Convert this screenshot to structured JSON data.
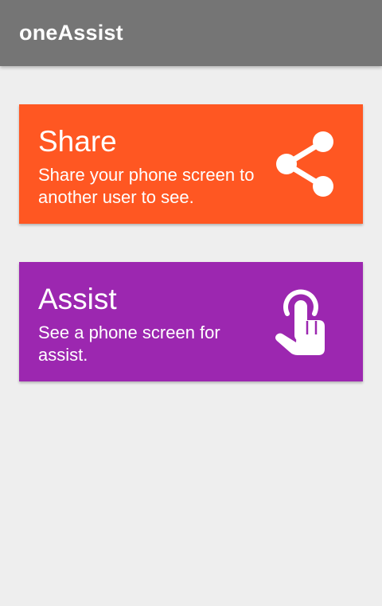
{
  "app_bar": {
    "title": "oneAssist"
  },
  "cards": [
    {
      "title": "Share",
      "subtitle": "Share your phone screen to another user to see.",
      "icon": "share-icon",
      "color": "#ff5722"
    },
    {
      "title": "Assist",
      "subtitle": "See a phone screen for assist.",
      "icon": "touch-hand-icon",
      "color": "#9c27b0"
    }
  ],
  "colors": {
    "app_bar": "#757575",
    "background": "#eeeeee",
    "text": "#ffffff"
  }
}
